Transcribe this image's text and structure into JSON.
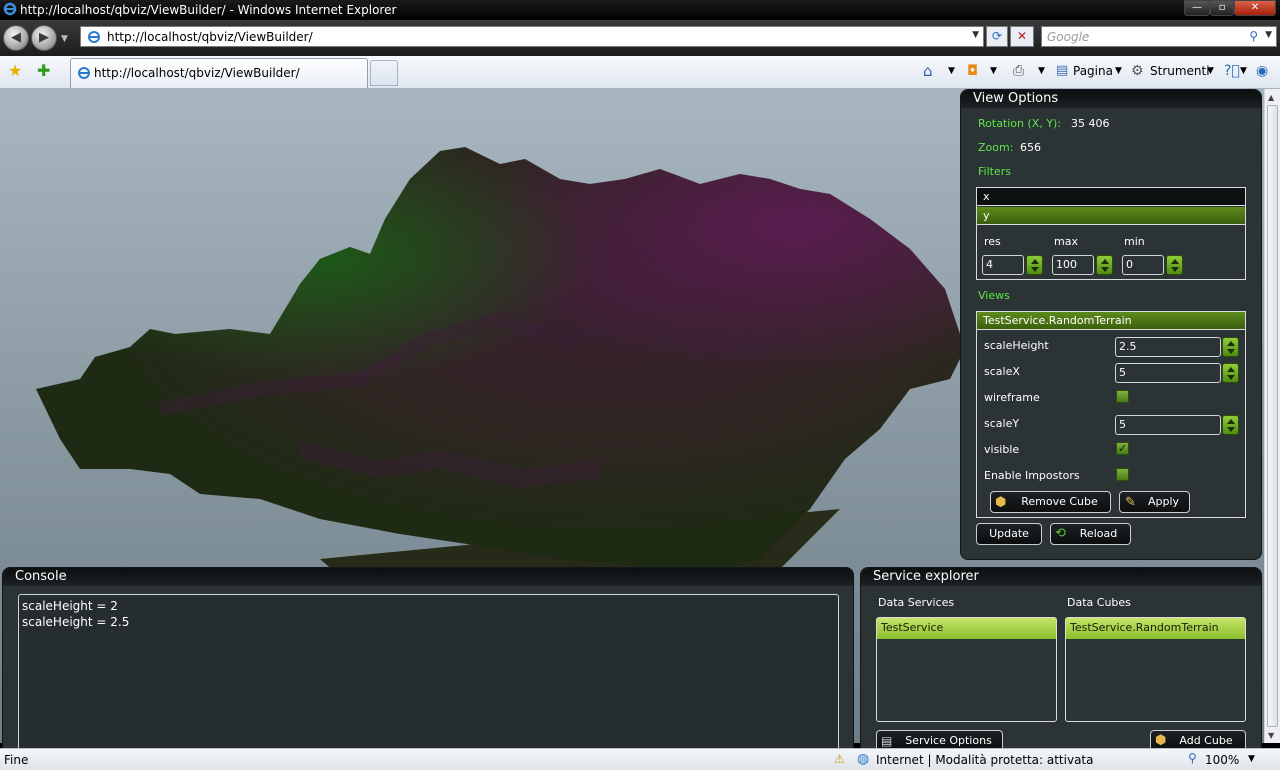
{
  "window": {
    "title": "http://localhost/qbviz/ViewBuilder/ - Windows Internet Explorer"
  },
  "nav": {
    "address": "http://localhost/qbviz/ViewBuilder/",
    "search_placeholder": "Google"
  },
  "tab": {
    "label": "http://localhost/qbviz/ViewBuilder/"
  },
  "commands": {
    "page": "Pagina",
    "tools": "Strumenti"
  },
  "view_options": {
    "title": "View Options",
    "rotation_label": "Rotation (X, Y):",
    "rotation_value": "35 406",
    "zoom_label": "Zoom:",
    "zoom_value": "656",
    "filters_label": "Filters",
    "filter_items": [
      "x",
      "y"
    ],
    "filter_fields": [
      {
        "label": "res",
        "value": "4"
      },
      {
        "label": "max",
        "value": "100"
      },
      {
        "label": "min",
        "value": "0"
      }
    ],
    "views_label": "Views",
    "view_name": "TestService.RandomTerrain",
    "props": {
      "scaleHeight_label": "scaleHeight",
      "scaleHeight_value": "2.5",
      "scaleX_label": "scaleX",
      "scaleX_value": "5",
      "wireframe_label": "wireframe",
      "scaleY_label": "scaleY",
      "scaleY_value": "5",
      "visible_label": "visible",
      "impostors_label": "Enable Impostors"
    },
    "remove_cube": "Remove Cube",
    "apply": "Apply",
    "update": "Update",
    "reload": "Reload"
  },
  "console": {
    "title": "Console",
    "lines": [
      "scaleHeight = 2",
      "scaleHeight = 2.5"
    ]
  },
  "service_explorer": {
    "title": "Service explorer",
    "data_services_label": "Data Services",
    "data_cubes_label": "Data Cubes",
    "services": [
      "TestService"
    ],
    "cubes": [
      "TestService.RandomTerrain"
    ],
    "service_options": "Service Options",
    "add_cube": "Add Cube"
  },
  "status": {
    "left": "Fine",
    "zone": "Internet | Modalità protetta: attivata",
    "zoom": "100%"
  }
}
